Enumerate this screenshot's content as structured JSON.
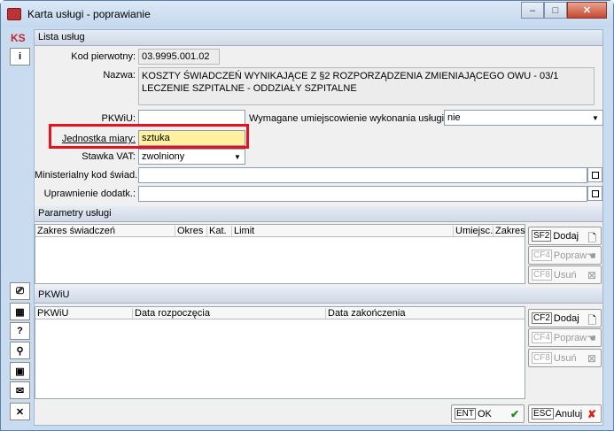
{
  "window": {
    "title": "Karta usługi - poprawianie",
    "min": "–",
    "max": "□",
    "close": "✕"
  },
  "toolbar": {
    "logo": "KS",
    "info": "i",
    "monitor": "⎚",
    "calc": "▦",
    "help": "?",
    "search": "⚲",
    "id": "▣",
    "mail": "✉",
    "exit": "✕"
  },
  "sections": {
    "lista": "Lista usług",
    "params": "Parametry usługi",
    "pkwiu": "PKWiU"
  },
  "form": {
    "kod_label": "Kod pierwotny:",
    "kod_value": "03.9995.001.02",
    "nazwa_label": "Nazwa:",
    "nazwa_value": "KOSZTY ŚWIADCZEŃ WYNIKAJĄCE Z §2 ROZPORZĄDZENIA ZMIENIAJĄCEGO OWU - 03/1 LECZENIE SZPITALNE - ODDZIAŁY SZPITALNE",
    "pkwiu_label": "PKWiU:",
    "pkwiu_value": "",
    "wym_label": "Wymagane umiejscowienie wykonania usługi:",
    "wym_value": "nie",
    "jm_label": "Jednostka miary:",
    "jm_value": "sztuka",
    "vat_label": "Stawka VAT:",
    "vat_value": "zwolniony",
    "min_label": "Ministerialny kod świad.:",
    "min_value": "",
    "upr_label": "Uprawnienie dodatk.:",
    "upr_value": ""
  },
  "params_grid": {
    "headers": [
      "Zakres świadczeń",
      "Okres",
      "Kat.",
      "Limit",
      "Umiejsc.",
      "Zakres"
    ]
  },
  "pkwiu_grid": {
    "headers": [
      "PKWiU",
      "Data rozpoczęcia",
      "Data zakończenia"
    ]
  },
  "buttons": {
    "add1_key": "SF2",
    "add1": "Dodaj",
    "edit1_key": "CF4",
    "edit1": "Popraw",
    "del1_key": "CF8",
    "del1": "Usuń",
    "add2_key": "CF2",
    "add2": "Dodaj",
    "edit2_key": "CF4",
    "edit2": "Popraw",
    "del2_key": "CF8",
    "del2": "Usuń",
    "ok_key": "ENT",
    "ok": "OK",
    "cancel_key": "ESC",
    "cancel": "Anuluj"
  },
  "colors": {
    "highlight_field": "#fdf0a0",
    "annotation": "#e8121c",
    "ok_check": "#1c8e1c",
    "cancel_x": "#d21"
  }
}
